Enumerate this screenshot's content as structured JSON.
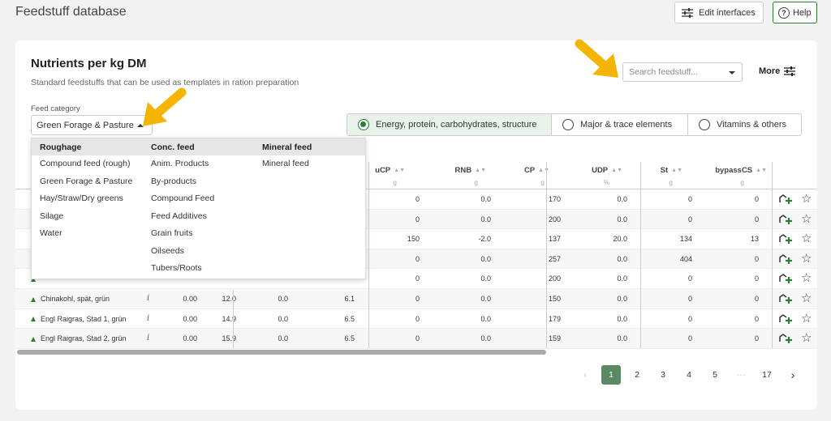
{
  "app": {
    "title": "Feedstuff database"
  },
  "header": {
    "edit_label": "Edit interfaces",
    "help_label": "Help"
  },
  "card": {
    "title": "Nutrients per kg DM",
    "subtitle": "Standard feedstuffs that can be used as templates in ration preparation",
    "search_placeholder": "Search feedstuff...",
    "more_label": "More"
  },
  "category": {
    "label": "Feed category",
    "selected": "Green Forage & Pasture"
  },
  "view_options": [
    {
      "label": "Energy, protein, carbohydrates, structure",
      "selected": true
    },
    {
      "label": "Major & trace elements",
      "selected": false
    },
    {
      "label": "Vitamins & others",
      "selected": false
    }
  ],
  "dropdown": {
    "columns": [
      {
        "title": "Roughage",
        "items": [
          "Compound feed (rough)",
          "Green Forage & Pasture",
          "Hay/Straw/Dry greens",
          "Silage",
          "Water"
        ]
      },
      {
        "title": "Conc. feed",
        "items": [
          "Anim. Products",
          "By-products",
          "Compound Feed",
          "Feed Additives",
          "Grain fruits",
          "Oilseeds",
          "Tubers/Roots"
        ]
      },
      {
        "title": "Mineral feed",
        "items": [
          "Mineral feed"
        ]
      }
    ]
  },
  "table": {
    "columns": [
      {
        "label": "uCP",
        "unit": "g"
      },
      {
        "label": "RNB",
        "unit": "g"
      },
      {
        "label": "CP",
        "unit": "g"
      },
      {
        "label": "UDP",
        "unit": "%"
      },
      {
        "label": "St",
        "unit": "g"
      },
      {
        "label": "bypassCS",
        "unit": "g"
      }
    ],
    "rows": [
      {
        "name": "",
        "c1": "",
        "c2": "",
        "c3": "",
        "c4": "",
        "uCP": "0",
        "RNB": "0.0",
        "CP": "170",
        "UDP": "0.0",
        "St": "0",
        "bypassCS": "0"
      },
      {
        "name": "",
        "c1": "",
        "c2": "",
        "c3": "",
        "c4": "",
        "uCP": "0",
        "RNB": "0.0",
        "CP": "200",
        "UDP": "0.0",
        "St": "0",
        "bypassCS": "0"
      },
      {
        "name": "",
        "c1": "",
        "c2": "",
        "c3": "",
        "c4": "",
        "uCP": "150",
        "RNB": "-2.0",
        "CP": "137",
        "UDP": "20.0",
        "St": "134",
        "bypassCS": "13"
      },
      {
        "name": "",
        "c1": "",
        "c2": "",
        "c3": "",
        "c4": "",
        "uCP": "0",
        "RNB": "0.0",
        "CP": "257",
        "UDP": "0.0",
        "St": "404",
        "bypassCS": "0"
      },
      {
        "name": "",
        "c1": "",
        "c2": "",
        "c3": "",
        "c4": "",
        "uCP": "0",
        "RNB": "0.0",
        "CP": "200",
        "UDP": "0.0",
        "St": "0",
        "bypassCS": "0"
      },
      {
        "name": "Chinakohl, spät, grün",
        "c1": "0.00",
        "c2": "12.0",
        "c3": "0.0",
        "c4": "6.1",
        "uCP": "0",
        "RNB": "0.0",
        "CP": "150",
        "UDP": "0.0",
        "St": "0",
        "bypassCS": "0"
      },
      {
        "name": "Engl Raigras, Stad 1, grün",
        "c1": "0.00",
        "c2": "14.9",
        "c3": "0.0",
        "c4": "6.5",
        "uCP": "0",
        "RNB": "0.0",
        "CP": "179",
        "UDP": "0.0",
        "St": "0",
        "bypassCS": "0"
      },
      {
        "name": "Engl Raigras, Stad 2, grün",
        "c1": "0.00",
        "c2": "15.9",
        "c3": "0.0",
        "c4": "6.5",
        "uCP": "0",
        "RNB": "0.0",
        "CP": "159",
        "UDP": "0.0",
        "St": "0",
        "bypassCS": "0"
      }
    ]
  },
  "pagination": {
    "pages": [
      "1",
      "2",
      "3",
      "4",
      "5",
      "···",
      "17"
    ],
    "current": "1"
  },
  "colors": {
    "accent": "#2e7d32",
    "pager_active": "#5a8a64",
    "arrow": "#f5b400"
  }
}
